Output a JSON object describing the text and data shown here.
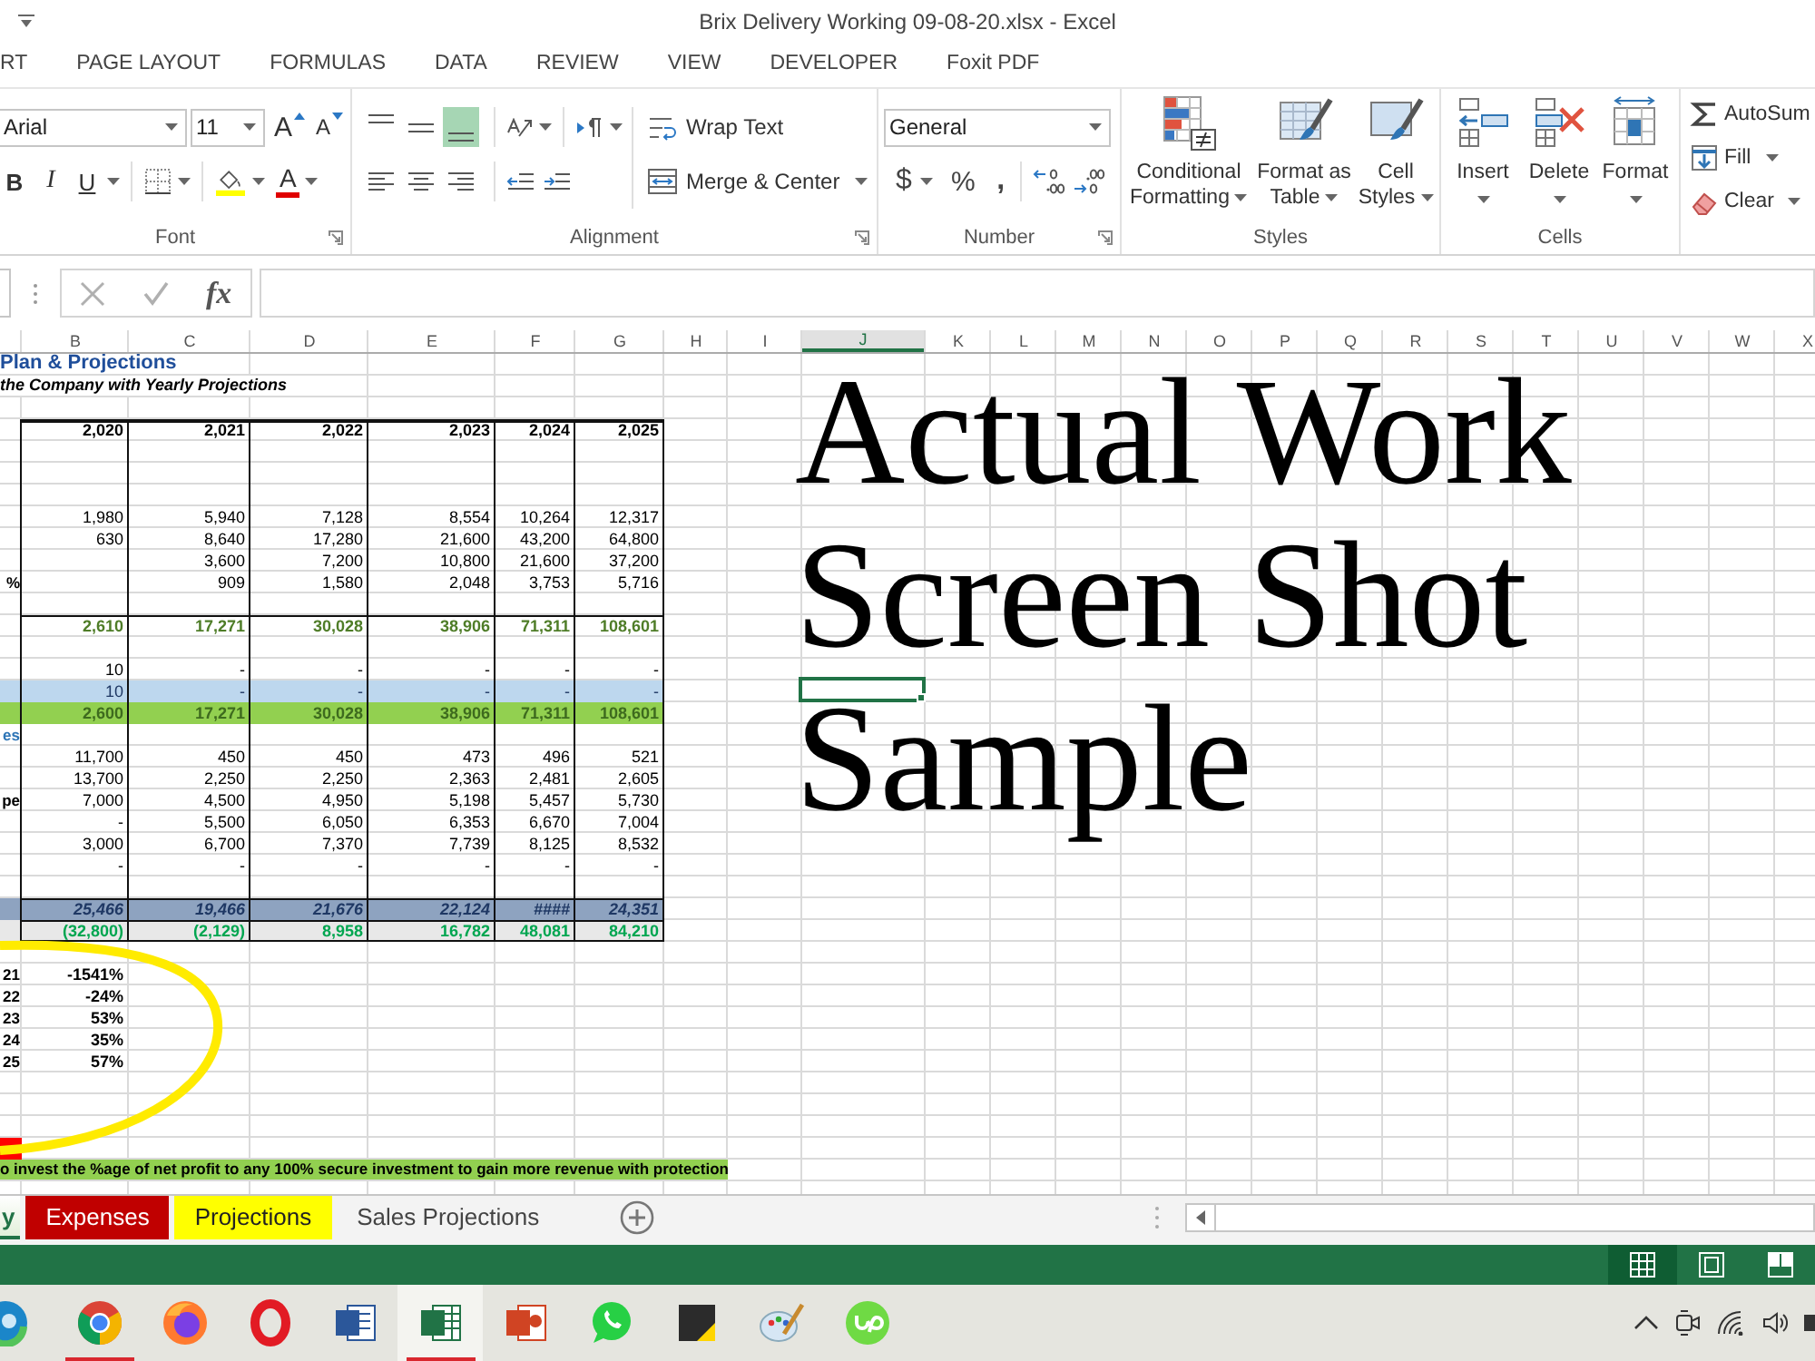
{
  "window": {
    "title": "Brix Delivery Working 09-08-20.xlsx - Excel"
  },
  "menu_tabs": [
    {
      "label": "RT",
      "selected": false
    },
    {
      "label": "PAGE LAYOUT",
      "selected": false
    },
    {
      "label": "FORMULAS",
      "selected": false
    },
    {
      "label": "DATA",
      "selected": false
    },
    {
      "label": "REVIEW",
      "selected": false
    },
    {
      "label": "VIEW",
      "selected": false
    },
    {
      "label": "DEVELOPER",
      "selected": false
    },
    {
      "label": "Foxit PDF",
      "selected": false
    }
  ],
  "ribbon": {
    "font": {
      "label": "Font",
      "font_name": "Arial",
      "font_size": "11",
      "grow_font": "A",
      "shrink_font": "A",
      "bold": "B",
      "italic": "I",
      "underline": "U",
      "font_color": "A"
    },
    "alignment": {
      "label": "Alignment",
      "vertical": [
        {
          "kind": "top",
          "selected": false
        },
        {
          "kind": "middle",
          "selected": false
        },
        {
          "kind": "bottom",
          "selected": true
        }
      ],
      "wrap_text": "Wrap Text",
      "merge": "Merge & Center"
    },
    "number": {
      "label": "Number",
      "format": "General",
      "currency": "$",
      "percent": "%",
      "comma": ","
    },
    "styles": {
      "label": "Styles",
      "buttons": [
        {
          "kind": "conditional",
          "label": "Conditional Formatting"
        },
        {
          "kind": "table",
          "label": "Format as Table"
        },
        {
          "kind": "cell_styles",
          "label": "Cell Styles"
        }
      ]
    },
    "cells": {
      "label": "Cells",
      "buttons": [
        {
          "kind": "insert",
          "label": "Insert"
        },
        {
          "kind": "delete",
          "label": "Delete"
        },
        {
          "kind": "format",
          "label": "Format"
        }
      ]
    },
    "editing": {
      "buttons": [
        {
          "kind": "autosum",
          "label": "AutoSum"
        },
        {
          "kind": "fill",
          "label": "Fill"
        },
        {
          "kind": "clear",
          "label": "Clear"
        }
      ]
    }
  },
  "formula_bar": {
    "function_label": "fx"
  },
  "sheet": {
    "columns": [
      {
        "label": "B",
        "selected": false
      },
      {
        "label": "C",
        "selected": false
      },
      {
        "label": "D",
        "selected": false
      },
      {
        "label": "E",
        "selected": false
      },
      {
        "label": "F",
        "selected": false
      },
      {
        "label": "G",
        "selected": false
      },
      {
        "label": "H",
        "selected": false
      },
      {
        "label": "I",
        "selected": false
      },
      {
        "label": "J",
        "selected": true
      },
      {
        "label": "K",
        "selected": false
      },
      {
        "label": "L",
        "selected": false
      },
      {
        "label": "M",
        "selected": false
      },
      {
        "label": "N",
        "selected": false
      },
      {
        "label": "O",
        "selected": false
      },
      {
        "label": "P",
        "selected": false
      },
      {
        "label": "Q",
        "selected": false
      },
      {
        "label": "R",
        "selected": false
      },
      {
        "label": "S",
        "selected": false
      },
      {
        "label": "T",
        "selected": false
      },
      {
        "label": "U",
        "selected": false
      },
      {
        "label": "V",
        "selected": false
      },
      {
        "label": "W",
        "selected": false
      },
      {
        "label": "X",
        "selected": false
      }
    ],
    "rows": [
      {
        "kind": "title",
        "text": "Plan & Projections",
        "selected": false
      },
      {
        "kind": "subtitle",
        "text": "the Company with Yearly Projections",
        "selected": false
      },
      {
        "kind": "blank",
        "selected": false
      },
      {
        "kind": "header",
        "cells": [
          "2,020",
          "2,021",
          "2,022",
          "2,023",
          "2,024",
          "2,025"
        ],
        "selected": false
      },
      {
        "kind": "boxed",
        "selected": false
      },
      {
        "kind": "boxed",
        "selected": false
      },
      {
        "kind": "boxed",
        "selected": false
      },
      {
        "kind": "data",
        "cells": [
          "1,980",
          "5,940",
          "7,128",
          "8,554",
          "10,264",
          "12,317"
        ],
        "selected": false
      },
      {
        "kind": "data",
        "cells": [
          "630",
          "8,640",
          "17,280",
          "21,600",
          "43,200",
          "64,800"
        ],
        "selected": false
      },
      {
        "kind": "data",
        "cells": [
          null,
          "3,600",
          "7,200",
          "10,800",
          "21,600",
          "37,200"
        ],
        "selected": false
      },
      {
        "kind": "data",
        "label": "%",
        "cells": [
          null,
          "909",
          "1,580",
          "2,048",
          "3,753",
          "5,716"
        ],
        "selected": false
      },
      {
        "kind": "boxed",
        "selected": false
      },
      {
        "kind": "total",
        "cells": [
          "2,610",
          "17,271",
          "30,028",
          "38,906",
          "71,311",
          "108,601"
        ],
        "selected": false
      },
      {
        "kind": "boxed",
        "selected": false
      },
      {
        "kind": "data",
        "cells": [
          "10",
          "-",
          "-",
          "-",
          "-",
          "-"
        ],
        "selected": false
      },
      {
        "kind": "blue",
        "cells": [
          "10",
          "-",
          "-",
          "-",
          "-",
          "-"
        ],
        "selected": true
      },
      {
        "kind": "green",
        "cells": [
          "2,600",
          "17,271",
          "30,028",
          "38,906",
          "71,311",
          "108,601"
        ],
        "selected": false
      },
      {
        "kind": "section",
        "label": "es",
        "selected": false
      },
      {
        "kind": "data",
        "cells": [
          "11,700",
          "450",
          "450",
          "473",
          "496",
          "521"
        ],
        "selected": false
      },
      {
        "kind": "data",
        "cells": [
          "13,700",
          "2,250",
          "2,250",
          "2,363",
          "2,481",
          "2,605"
        ],
        "selected": false
      },
      {
        "kind": "data",
        "label": "pe",
        "cells": [
          "7,000",
          "4,500",
          "4,950",
          "5,198",
          "5,457",
          "5,730"
        ],
        "selected": false
      },
      {
        "kind": "data",
        "cells": [
          "-",
          "5,500",
          "6,050",
          "6,353",
          "6,670",
          "7,004"
        ],
        "selected": false
      },
      {
        "kind": "data",
        "cells": [
          "3,000",
          "6,700",
          "7,370",
          "7,739",
          "8,125",
          "8,532"
        ],
        "selected": false
      },
      {
        "kind": "data",
        "cells": [
          "-",
          "-",
          "-",
          "-",
          "-",
          "-"
        ],
        "selected": false
      },
      {
        "kind": "boxed",
        "selected": false
      },
      {
        "kind": "subtotal",
        "cells": [
          "25,466",
          "19,466",
          "21,676",
          "22,124",
          "####",
          "24,351"
        ],
        "selected": false
      },
      {
        "kind": "net",
        "cells": [
          "(32,800)",
          "(2,129)",
          "8,958",
          "16,782",
          "48,081",
          "84,210"
        ],
        "selected": false
      },
      {
        "kind": "blank",
        "selected": false
      },
      {
        "kind": "percent",
        "label": "21",
        "cells": [
          "-1541%"
        ],
        "selected": false
      },
      {
        "kind": "percent",
        "label": "22",
        "cells": [
          "-24%"
        ],
        "selected": false
      },
      {
        "kind": "percent",
        "label": "23",
        "cells": [
          "53%"
        ],
        "selected": false
      },
      {
        "kind": "percent",
        "label": "24",
        "cells": [
          "35%"
        ],
        "selected": false
      },
      {
        "kind": "percent",
        "label": "25",
        "cells": [
          "57%"
        ],
        "selected": false
      },
      {
        "kind": "blank",
        "selected": false
      },
      {
        "kind": "blank",
        "selected": false
      },
      {
        "kind": "blank",
        "selected": false
      },
      {
        "kind": "flag",
        "selected": false
      },
      {
        "kind": "note",
        "text": "o invest the %age of net profit to any 100% secure investment to gain more revenue with protection",
        "selected": false
      }
    ],
    "overlay_text": [
      "Actual Work",
      "Screen Shot",
      "Sample"
    ]
  },
  "sheet_tabs": [
    {
      "label": "y",
      "selected": true
    },
    {
      "label": "Expenses",
      "selected": false,
      "color": "#c00000"
    },
    {
      "label": "Projections",
      "selected": false,
      "color": "#ffff00"
    },
    {
      "label": "Sales Projections",
      "selected": false
    }
  ],
  "status_bar": {
    "views": [
      {
        "kind": "normal",
        "selected": true
      },
      {
        "kind": "page_layout",
        "selected": false
      },
      {
        "kind": "page_break",
        "selected": false
      }
    ]
  },
  "taskbar": {
    "apps": [
      {
        "kind": "swirl",
        "selected": false,
        "running": false
      },
      {
        "kind": "wheel",
        "selected": false,
        "running": true
      },
      {
        "kind": "fox",
        "selected": false,
        "running": false
      },
      {
        "kind": "ring",
        "selected": false,
        "running": false
      },
      {
        "kind": "doc",
        "selected": false,
        "running": false
      },
      {
        "kind": "sheet",
        "selected": true,
        "running": true
      },
      {
        "kind": "slides",
        "selected": false,
        "running": false
      },
      {
        "kind": "chat",
        "selected": false,
        "running": false
      },
      {
        "kind": "note",
        "selected": false,
        "running": false
      },
      {
        "kind": "palette",
        "selected": false,
        "running": false
      },
      {
        "kind": "badge",
        "selected": false,
        "running": false
      }
    ]
  }
}
